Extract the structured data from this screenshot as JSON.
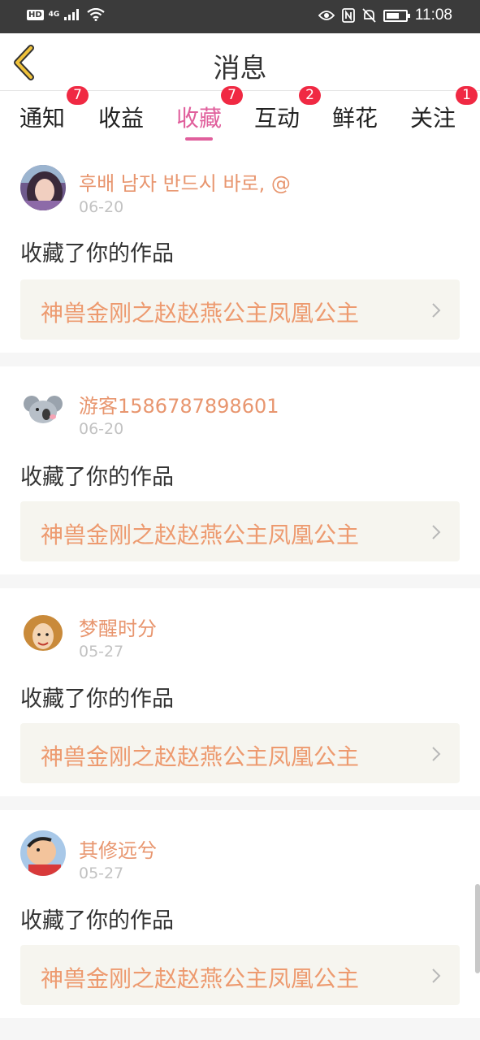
{
  "status_bar": {
    "hd_label": "HD",
    "network_label": "4G",
    "time": "11:08",
    "battery_level": 0.7
  },
  "header": {
    "title": "消息",
    "back_icon": "back-chevron-icon",
    "accent_color": "#f0c23b"
  },
  "tabs": [
    {
      "label": "通知",
      "badge": "7",
      "active": false
    },
    {
      "label": "收益",
      "badge": "",
      "active": false
    },
    {
      "label": "收藏",
      "badge": "7",
      "active": true
    },
    {
      "label": "互动",
      "badge": "2",
      "active": false
    },
    {
      "label": "鲜花",
      "badge": "",
      "active": false
    },
    {
      "label": "关注",
      "badge": "1",
      "active": false
    }
  ],
  "colors": {
    "active_tab": "#e05f9c",
    "badge": "#f02943",
    "username": "#e8966f",
    "work_title": "#ed9a6f"
  },
  "notifications": [
    {
      "username": "후배 남자 반드시 바로, @",
      "date": "06-20",
      "action": "收藏了你的作品",
      "work_title": "神兽金刚之赵赵燕公主凤凰公主",
      "avatar": "avatar-girl-portrait"
    },
    {
      "username": "游客1586787898601",
      "date": "06-20",
      "action": "收藏了你的作品",
      "work_title": "神兽金刚之赵赵燕公主凤凰公主",
      "avatar": "avatar-koala-cartoon"
    },
    {
      "username": "梦醒时分",
      "date": "05-27",
      "action": "收藏了你的作品",
      "work_title": "神兽金刚之赵赵燕公主凤凰公主",
      "avatar": "avatar-cartoon-woman"
    },
    {
      "username": "其修远兮",
      "date": "05-27",
      "action": "收藏了你的作品",
      "work_title": "神兽金刚之赵赵燕公主凤凰公主",
      "avatar": "avatar-cartoon-kid"
    }
  ]
}
